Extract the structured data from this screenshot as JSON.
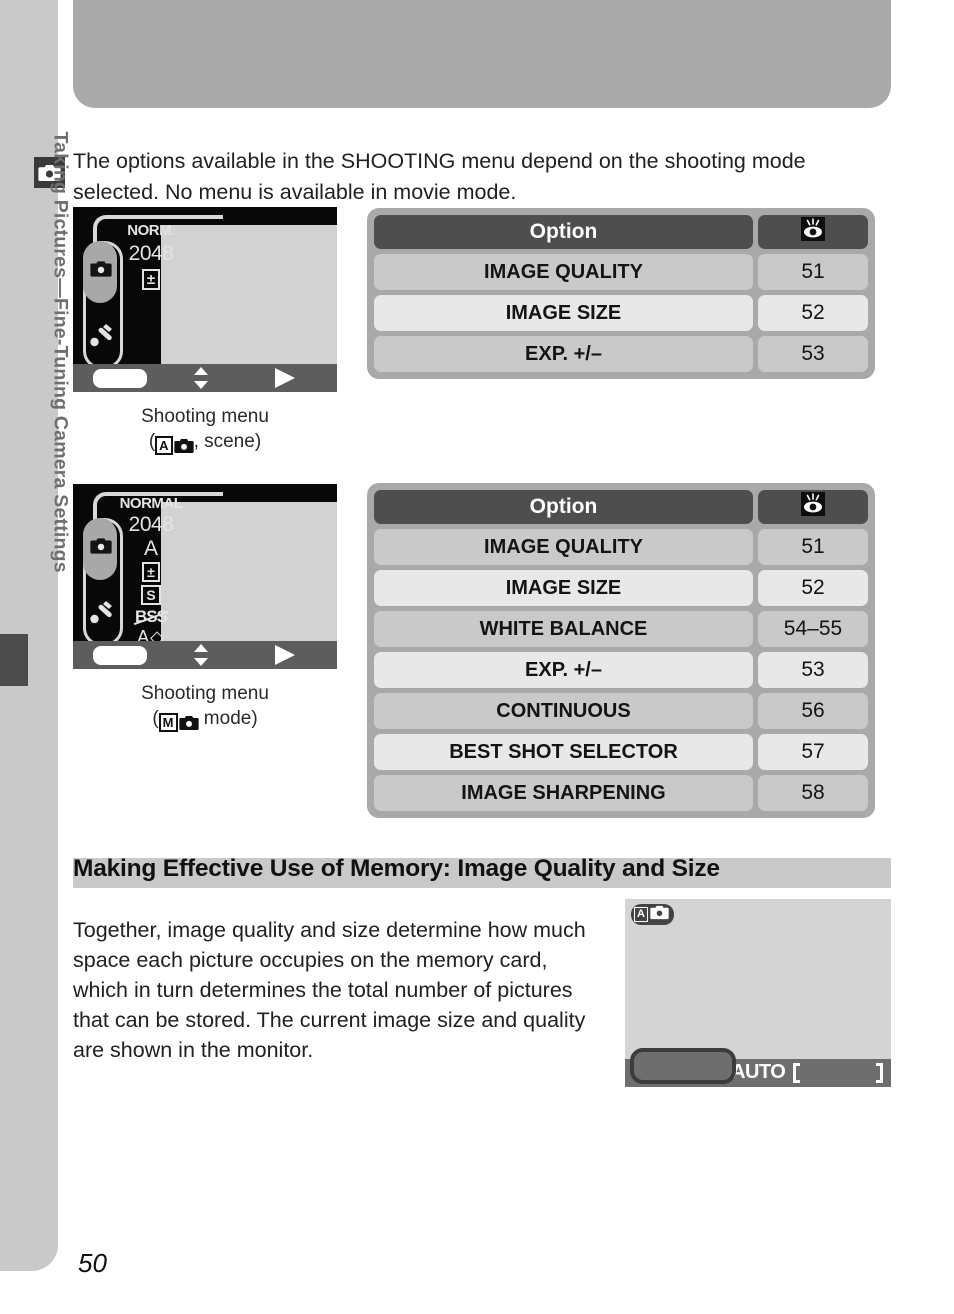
{
  "sidebar": {
    "chapter_title": "Taking Pictures—Fine-Tuning Camera Settings",
    "chapter_icon": "camera-icon"
  },
  "intro": {
    "paragraph": "The options available in the SHOOTING menu depend on the shooting mode selected.  No menu is available in movie mode."
  },
  "figures": [
    {
      "name": "shooting-menu-auto-scene",
      "caption_line1": "Shooting menu",
      "caption_prefix": "(",
      "caption_mode_letter": "A",
      "caption_suffix": ", scene)",
      "lcd_icons": [
        "NORM.",
        "2048",
        "±"
      ],
      "bottom_icons": [
        "white-button",
        "up-down-arrow-icon",
        "right-arrow-icon"
      ]
    },
    {
      "name": "shooting-menu-m-mode",
      "caption_line1": "Shooting menu",
      "caption_prefix": "(",
      "caption_mode_letter": "M",
      "caption_suffix": " mode)",
      "lcd_icons": [
        "NORMAL",
        "2048",
        "A",
        "±",
        "S",
        "BSS",
        "A◇"
      ],
      "bottom_icons": [
        "white-button",
        "up-down-arrow-icon",
        "right-arrow-icon"
      ]
    }
  ],
  "tables": [
    {
      "name": "shooting-menu-options-auto-scene",
      "header": {
        "option": "Option",
        "page_icon": "eye-reference-icon"
      },
      "rows": [
        {
          "option": "IMAGE QUALITY",
          "page": "51"
        },
        {
          "option": "IMAGE SIZE",
          "page": "52"
        },
        {
          "option": "EXP. +/–",
          "page": "53"
        }
      ]
    },
    {
      "name": "shooting-menu-options-m-mode",
      "header": {
        "option": "Option",
        "page_icon": "eye-reference-icon"
      },
      "rows": [
        {
          "option": "IMAGE QUALITY",
          "page": "51"
        },
        {
          "option": "IMAGE SIZE",
          "page": "52"
        },
        {
          "option": "WHITE BALANCE",
          "page": "54–55"
        },
        {
          "option": "EXP. +/–",
          "page": "53"
        },
        {
          "option": "CONTINUOUS",
          "page": "56"
        },
        {
          "option": "BEST SHOT SELECTOR",
          "page": "57"
        },
        {
          "option": "IMAGE SHARPENING",
          "page": "58"
        }
      ]
    }
  ],
  "section": {
    "heading": "Making Effective Use of Memory: Image Quality and Size",
    "body": "Together, image quality and size determine how much space each picture occupies on the memory card, which in turn determines the total number of pictures that can be stored.  The current image size and quality are shown in the monitor."
  },
  "monitor": {
    "name": "camera-monitor-figure",
    "mode_letter": "A",
    "mode_icon": "camera-icon",
    "status_text": "AUTO",
    "focus_brackets": "focus-brackets-icon",
    "highlight": "image-size-quality-highlight"
  },
  "page_number": "50",
  "colors": {
    "sidebar": "#c9c9c9",
    "top_band": "#aaaaaa",
    "table_frame": "#a9a9a9",
    "table_header": "#4e4e4e",
    "row_shade_a": "#c9c9c9",
    "row_shade_b": "#e8e8e8",
    "lcd_background": "#d2d2d2",
    "lcd_dark": "#080808"
  }
}
